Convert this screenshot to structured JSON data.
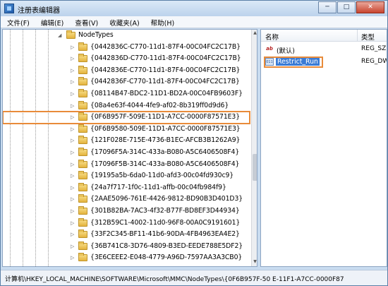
{
  "window": {
    "title": "注册表编辑器",
    "minimize": "─",
    "maximize": "□",
    "close": "✕"
  },
  "menu": [
    "文件(F)",
    "编辑(E)",
    "查看(V)",
    "收藏夹(A)",
    "帮助(H)"
  ],
  "tree": {
    "parent": "NodeTypes",
    "items": [
      "{0442836C-C770-11d1-87F4-00C04FC2C17B}",
      "{0442836D-C770-11d1-87F4-00C04FC2C17B}",
      "{0442836E-C770-11d1-87F4-00C04FC2C17B}",
      "{0442836F-C770-11d1-87F4-00C04FC2C17B}",
      "{08114B47-BDC2-11D1-BD2A-00C04FB9603F}",
      "{08a4e63f-4044-4fe9-af02-8b319ff0d9d6}",
      "{0F6B957F-509E-11D1-A7CC-0000F87571E3}",
      "{0F6B9580-509E-11D1-A7CC-0000F87571E3}",
      "{121F028E-715E-4736-B1EC-AFCB3B1262A9}",
      "{17096F5A-314C-433a-B080-A5C6406508F4}",
      "{17096F5B-314C-433a-B080-A5C6406508F4}",
      "{19195a5b-6da0-11d0-afd3-00c04fd930c9}",
      "{24a7f717-1f0c-11d1-affb-00c04fb984f9}",
      "{2AAE5096-761E-4426-9812-BD90B3D401D3}",
      "{301B82BA-7AC3-4f32-B77F-BD8EF3D44934}",
      "{312B59C1-4002-11d0-96F8-00A0C9191601}",
      "{33F2C345-BF11-41b6-90DA-4FB4963EA4E2}",
      "{36B741C8-3D76-4809-B3ED-EEDE788E5DF2}",
      "{3E6CEEE2-E048-4779-A96D-7597AA3A3CB0}"
    ],
    "highlighted_index": 6
  },
  "values": {
    "col_name": "名称",
    "col_type": "类型",
    "rows": [
      {
        "name": "(默认)",
        "type": "REG_SZ",
        "icon": "string-value-icon"
      },
      {
        "name": "Restrict_Run",
        "type": "REG_DWORD",
        "icon": "binary-value-icon"
      }
    ]
  },
  "status": {
    "path": "计算机\\HKEY_LOCAL_MACHINE\\SOFTWARE\\Microsoft\\MMC\\NodeTypes\\{0F6B957F-50 E-11F1-A7CC-0000F87"
  },
  "colors": {
    "highlight_outline": "#e88b3a",
    "selection_blue": "#3a7bd5"
  }
}
